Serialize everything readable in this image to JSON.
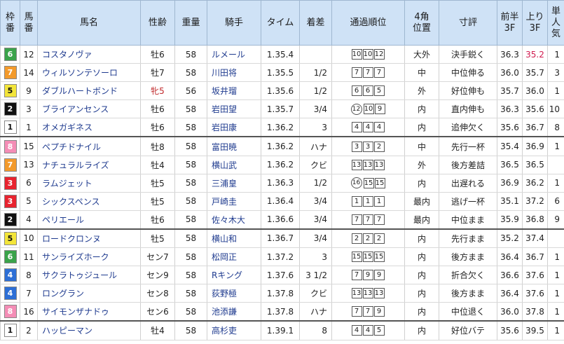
{
  "headers": {
    "waku": [
      "枠",
      "番"
    ],
    "umaban": [
      "馬",
      "番"
    ],
    "name": "馬名",
    "sexage": "性齢",
    "weight": "重量",
    "jockey": "騎手",
    "time": "タイム",
    "margin": "着差",
    "passing": "通過順位",
    "corner": [
      "4角",
      "位置"
    ],
    "comment": "寸評",
    "first3f": [
      "前半",
      "3F"
    ],
    "last3f": [
      "上り",
      "3F"
    ],
    "popularity": [
      "単",
      "人",
      "気"
    ]
  },
  "colors": {
    "waku1": "#ffffff",
    "waku2": "#111111",
    "waku3": "#e8232f",
    "waku4": "#2d6fd6",
    "waku5": "#f3e53a",
    "waku6": "#3aa34a",
    "waku7": "#f39a2b",
    "waku8": "#f48db6",
    "header_bg": "#cfe2f6",
    "link": "#1f3b8f",
    "highlight": "#d01b4f"
  },
  "rows": [
    {
      "waku": "6",
      "umaban": "12",
      "name": "コスタノヴァ",
      "sexage": "牡6",
      "weight": "58",
      "jockey": "ルメール",
      "time": "1.35.4",
      "margin": "",
      "passing": [
        "10",
        "10",
        "12"
      ],
      "corner": "大外",
      "comment": "決手鋭く",
      "f3f": "36.3",
      "l3f": "35.2",
      "l3f_hl": true,
      "pop": "1"
    },
    {
      "waku": "7",
      "umaban": "14",
      "name": "ウィルソンテソーロ",
      "sexage": "牡7",
      "weight": "58",
      "jockey": "川田将",
      "time": "1.35.5",
      "margin": "1/2",
      "passing": [
        "7",
        "7",
        "7"
      ],
      "corner": "中",
      "comment": "中位伸る",
      "f3f": "36.0",
      "l3f": "35.7",
      "pop": "3"
    },
    {
      "waku": "5",
      "umaban": "9",
      "name": "ダブルハートボンド",
      "sexage": "牝5",
      "sex_female": true,
      "weight": "56",
      "jockey": "坂井瑠",
      "time": "1.35.6",
      "margin": "1/2",
      "passing": [
        "6",
        "6",
        "5"
      ],
      "corner": "外",
      "comment": "好位伸も",
      "f3f": "35.7",
      "l3f": "36.0",
      "pop": "1"
    },
    {
      "waku": "2",
      "umaban": "3",
      "name": "ブライアンセンス",
      "sexage": "牡6",
      "weight": "58",
      "jockey": "岩田望",
      "time": "1.35.7",
      "margin": "3/4",
      "passing": [
        "12",
        "10",
        "9"
      ],
      "pass_circle": true,
      "corner": "内",
      "comment": "直内伸も",
      "f3f": "36.3",
      "l3f": "35.6",
      "pop": "10"
    },
    {
      "waku": "1",
      "umaban": "1",
      "name": "オメガギネス",
      "sexage": "牡6",
      "weight": "58",
      "jockey": "岩田康",
      "time": "1.36.2",
      "margin": "3",
      "passing": [
        "4",
        "4",
        "4"
      ],
      "corner": "内",
      "comment": "追伸欠く",
      "f3f": "35.6",
      "l3f": "36.7",
      "pop": "8"
    },
    {
      "waku": "8",
      "umaban": "15",
      "name": "ペプチドナイル",
      "sexage": "牡8",
      "weight": "58",
      "jockey": "富田暁",
      "time": "1.36.2",
      "margin": "ハナ",
      "passing": [
        "3",
        "3",
        "2"
      ],
      "corner": "中",
      "comment": "先行一杯",
      "f3f": "35.4",
      "l3f": "36.9",
      "pop": "1"
    },
    {
      "waku": "7",
      "umaban": "13",
      "name": "ナチュラルライズ",
      "sexage": "牡4",
      "weight": "58",
      "jockey": "横山武",
      "time": "1.36.2",
      "margin": "クビ",
      "passing": [
        "13",
        "13",
        "13"
      ],
      "corner": "外",
      "comment": "後方差詰",
      "f3f": "36.5",
      "l3f": "36.5",
      "pop": ""
    },
    {
      "waku": "3",
      "umaban": "6",
      "name": "ラムジェット",
      "sexage": "牡5",
      "weight": "58",
      "jockey": "三浦皇",
      "time": "1.36.3",
      "margin": "1/2",
      "passing": [
        "16",
        "15",
        "15"
      ],
      "pass_circle": true,
      "corner": "内",
      "comment": "出遅れる",
      "f3f": "36.9",
      "l3f": "36.2",
      "pop": "1"
    },
    {
      "waku": "3",
      "umaban": "5",
      "name": "シックスペンス",
      "sexage": "牡5",
      "weight": "58",
      "jockey": "戸崎圭",
      "time": "1.36.4",
      "margin": "3/4",
      "passing": [
        "1",
        "1",
        "1"
      ],
      "corner": "最内",
      "comment": "逃げ一杯",
      "f3f": "35.1",
      "l3f": "37.2",
      "pop": "6"
    },
    {
      "waku": "2",
      "umaban": "4",
      "name": "ペリエール",
      "sexage": "牡6",
      "weight": "58",
      "jockey": "佐々木大",
      "time": "1.36.6",
      "margin": "3/4",
      "passing": [
        "7",
        "7",
        "7"
      ],
      "corner": "最内",
      "comment": "中位まま",
      "f3f": "35.9",
      "l3f": "36.8",
      "pop": "9"
    },
    {
      "waku": "5",
      "umaban": "10",
      "name": "ロードクロンヌ",
      "sexage": "牡5",
      "weight": "58",
      "jockey": "横山和",
      "time": "1.36.7",
      "margin": "3/4",
      "passing": [
        "2",
        "2",
        "2"
      ],
      "corner": "内",
      "comment": "先行まま",
      "f3f": "35.2",
      "l3f": "37.4",
      "pop": ""
    },
    {
      "waku": "6",
      "umaban": "11",
      "name": "サンライズホーク",
      "sexage": "セン7",
      "weight": "58",
      "jockey": "松岡正",
      "time": "1.37.2",
      "margin": "3",
      "passing": [
        "15",
        "15",
        "15"
      ],
      "corner": "内",
      "comment": "後方まま",
      "f3f": "36.4",
      "l3f": "36.7",
      "pop": "1"
    },
    {
      "waku": "4",
      "umaban": "8",
      "name": "サクラトゥジュール",
      "sexage": "セン9",
      "weight": "58",
      "jockey": "Rキング",
      "time": "1.37.6",
      "margin": "3 1/2",
      "passing": [
        "7",
        "9",
        "9"
      ],
      "corner": "内",
      "comment": "折合欠く",
      "f3f": "36.6",
      "l3f": "37.6",
      "pop": "1"
    },
    {
      "waku": "4",
      "umaban": "7",
      "name": "ロングラン",
      "sexage": "セン8",
      "weight": "58",
      "jockey": "荻野極",
      "time": "1.37.8",
      "margin": "クビ",
      "passing": [
        "13",
        "13",
        "13"
      ],
      "corner": "内",
      "comment": "後方まま",
      "f3f": "36.4",
      "l3f": "37.6",
      "pop": "1"
    },
    {
      "waku": "8",
      "umaban": "16",
      "name": "サイモンザナドゥ",
      "sexage": "セン6",
      "weight": "58",
      "jockey": "池添謙",
      "time": "1.37.8",
      "margin": "ハナ",
      "passing": [
        "7",
        "7",
        "9"
      ],
      "corner": "内",
      "comment": "中位退く",
      "f3f": "36.0",
      "l3f": "37.8",
      "pop": "1"
    },
    {
      "waku": "1",
      "umaban": "2",
      "name": "ハッピーマン",
      "sexage": "牡4",
      "weight": "58",
      "jockey": "高杉吏",
      "time": "1.39.1",
      "margin": "8",
      "passing": [
        "4",
        "4",
        "5"
      ],
      "corner": "内",
      "comment": "好位バテ",
      "f3f": "35.6",
      "l3f": "39.5",
      "pop": "1"
    }
  ]
}
